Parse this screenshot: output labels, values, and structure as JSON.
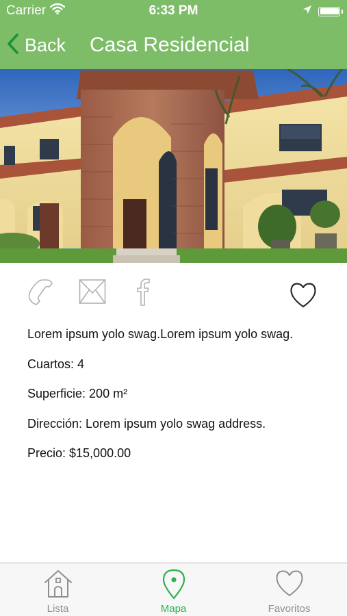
{
  "status_bar": {
    "carrier": "Carrier",
    "time": "6:33 PM",
    "battery_level": 1.0
  },
  "nav": {
    "back_label": "Back",
    "title": "Casa Residencial"
  },
  "hero": {
    "image_description_icon": "house-photo"
  },
  "actions": {
    "phone_icon": "phone-icon",
    "email_icon": "envelope-icon",
    "facebook_icon": "facebook-icon",
    "favorite_icon": "heart-icon"
  },
  "details": {
    "description": "Lorem ipsum yolo swag.Lorem ipsum yolo swag.",
    "rooms": "Cuartos: 4",
    "area": "Superficie: 200 m²",
    "address": "Dirección: Lorem ipsum yolo swag address.",
    "price": "Precio: $15,000.00"
  },
  "tab_bar": {
    "tabs": [
      {
        "label": "Lista",
        "icon": "house-icon",
        "active": false
      },
      {
        "label": "Mapa",
        "icon": "map-pin-icon",
        "active": true
      },
      {
        "label": "Favoritos",
        "icon": "heart-icon",
        "active": false
      }
    ]
  },
  "colors": {
    "header_green": "#7dbd68",
    "active_tab": "#2bb24c",
    "inactive_tab": "#8e8e8e",
    "icon_gray": "#b0b0b0"
  }
}
